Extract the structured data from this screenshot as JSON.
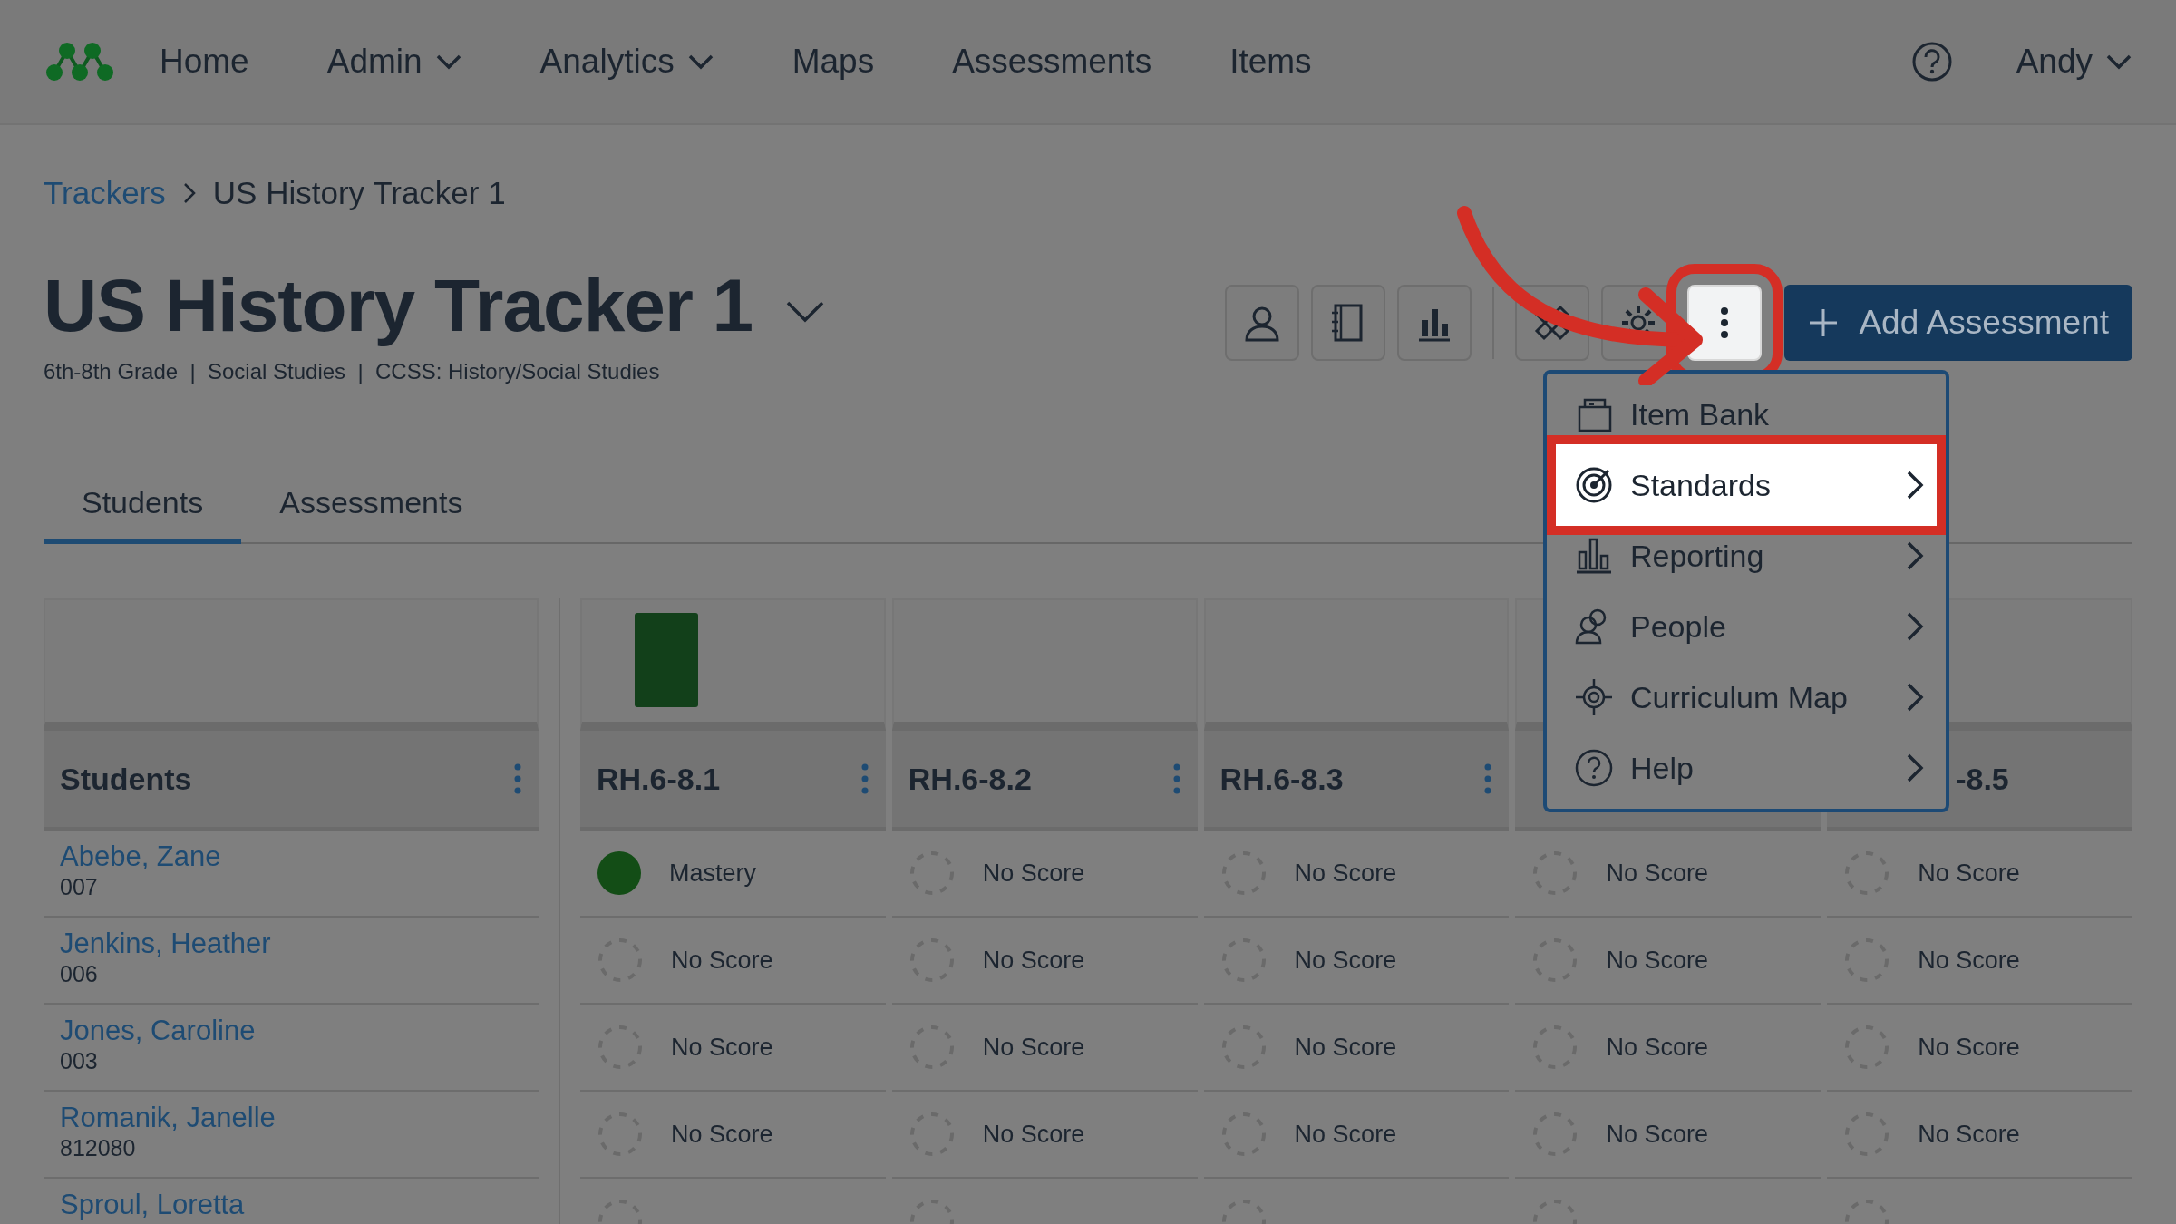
{
  "navbar": {
    "items": [
      {
        "label": "Home",
        "dropdown": false
      },
      {
        "label": "Admin",
        "dropdown": true
      },
      {
        "label": "Analytics",
        "dropdown": true
      },
      {
        "label": "Maps",
        "dropdown": false
      },
      {
        "label": "Assessments",
        "dropdown": false
      },
      {
        "label": "Items",
        "dropdown": false
      }
    ],
    "user": {
      "label": "Andy",
      "dropdown": true
    }
  },
  "breadcrumb": [
    {
      "label": "Trackers",
      "link": true
    },
    {
      "label": "US History Tracker 1",
      "link": false
    }
  ],
  "title": "US History Tracker 1",
  "subtitle": "6th-8th Grade  |  Social Studies  |  CCSS: History/Social Studies",
  "toolbar": [
    {
      "kind": "user",
      "highlighted": false
    },
    {
      "kind": "notebook",
      "highlighted": false
    },
    {
      "kind": "chart",
      "highlighted": false
    },
    {
      "kind": "tools",
      "highlighted": false
    },
    {
      "kind": "gear",
      "highlighted": false
    },
    {
      "kind": "more",
      "highlighted": true
    }
  ],
  "add_button": "Add Assessment",
  "menu": [
    {
      "kind": "itembank",
      "label": "Item Bank",
      "submenu": false,
      "selected": false
    },
    {
      "kind": "target",
      "label": "Standards",
      "submenu": true,
      "selected": true
    },
    {
      "kind": "reporting",
      "label": "Reporting",
      "submenu": true,
      "selected": false
    },
    {
      "kind": "people",
      "label": "People",
      "submenu": true,
      "selected": false
    },
    {
      "kind": "map",
      "label": "Curriculum Map",
      "submenu": true,
      "selected": false
    },
    {
      "kind": "help",
      "label": "Help",
      "submenu": true,
      "selected": false
    }
  ],
  "tabs": [
    {
      "label": "Students",
      "selected": true
    },
    {
      "label": "Assessments",
      "selected": false
    }
  ],
  "table": {
    "first_column": "Students",
    "columns": [
      {
        "label": "RH.6-8.1",
        "bar": true
      },
      {
        "label": "RH.6-8.2",
        "bar": false
      },
      {
        "label": "RH.6-8.3",
        "bar": false
      },
      {
        "bar": false
      },
      {
        "label": "-8.5",
        "bar": false
      }
    ],
    "rows": [
      {
        "name": "Abebe, Zane",
        "id": "007",
        "scores": [
          {
            "kind": "mastery",
            "label": "Mastery"
          },
          {
            "kind": "noscore",
            "label": "No Score"
          },
          {
            "kind": "noscore",
            "label": "No Score"
          },
          {
            "kind": "noscore",
            "label": "No Score"
          },
          {
            "kind": "noscore",
            "label": "No Score"
          }
        ]
      },
      {
        "name": "Jenkins, Heather",
        "id": "006",
        "scores": [
          {
            "kind": "noscore",
            "label": "No Score"
          },
          {
            "kind": "noscore",
            "label": "No Score"
          },
          {
            "kind": "noscore",
            "label": "No Score"
          },
          {
            "kind": "noscore",
            "label": "No Score"
          },
          {
            "kind": "noscore",
            "label": "No Score"
          }
        ]
      },
      {
        "name": "Jones, Caroline",
        "id": "003",
        "scores": [
          {
            "kind": "noscore",
            "label": "No Score"
          },
          {
            "kind": "noscore",
            "label": "No Score"
          },
          {
            "kind": "noscore",
            "label": "No Score"
          },
          {
            "kind": "noscore",
            "label": "No Score"
          },
          {
            "kind": "noscore",
            "label": "No Score"
          }
        ]
      },
      {
        "name": "Romanik, Janelle",
        "id": "812080",
        "scores": [
          {
            "kind": "noscore",
            "label": "No Score"
          },
          {
            "kind": "noscore",
            "label": "No Score"
          },
          {
            "kind": "noscore",
            "label": "No Score"
          },
          {
            "kind": "noscore",
            "label": "No Score"
          },
          {
            "kind": "noscore",
            "label": "No Score"
          }
        ]
      },
      {
        "name": "Sproul, Loretta",
        "scores": [
          {
            "kind": "noscore"
          },
          {
            "kind": "noscore"
          },
          {
            "kind": "noscore"
          },
          {
            "kind": "noscore"
          },
          {
            "kind": "noscore"
          }
        ]
      }
    ]
  }
}
